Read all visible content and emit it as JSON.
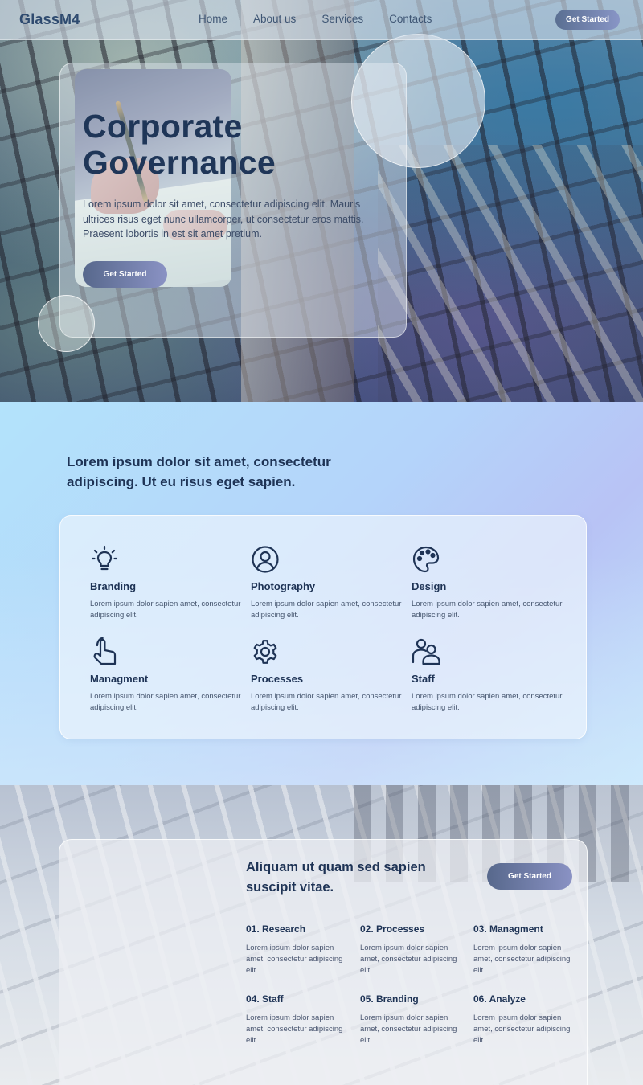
{
  "nav": {
    "logo": "GlassM4",
    "links": [
      "Home",
      "About us",
      "Services",
      "Contacts"
    ],
    "cta": "Get Started"
  },
  "hero": {
    "title": "Corporate Governance",
    "text": "Lorem ipsum dolor sit amet, consectetur adipiscing elit. Mauris ultrices risus eget nunc ullamcorper, ut consectetur eros mattis. Praesent lobortis in est sit amet pretium.",
    "cta": "Get Started"
  },
  "features": {
    "heading": "Lorem ipsum dolor sit amet, consectetur adipiscing. Ut eu risus eget sapien.",
    "items": [
      {
        "icon": "lightbulb-icon",
        "title": "Branding",
        "text": "Lorem ipsum dolor sapien amet, consectetur adipiscing elit."
      },
      {
        "icon": "user-circle-icon",
        "title": "Photography",
        "text": "Lorem ipsum dolor sapien amet, consectetur adipiscing elit."
      },
      {
        "icon": "palette-icon",
        "title": "Design",
        "text": "Lorem ipsum dolor sapien amet, consectetur adipiscing elit."
      },
      {
        "icon": "hand-pointer-icon",
        "title": "Managment",
        "text": "Lorem ipsum dolor sapien amet, consectetur adipiscing elit."
      },
      {
        "icon": "gear-icon",
        "title": "Processes",
        "text": "Lorem ipsum dolor sapien amet, consectetur adipiscing elit."
      },
      {
        "icon": "users-icon",
        "title": "Staff",
        "text": "Lorem ipsum dolor sapien amet, consectetur adipiscing elit."
      }
    ]
  },
  "process": {
    "title": "Aliquam ut quam sed sapien suscipit vitae.",
    "cta": "Get Started",
    "steps": [
      {
        "title": "01. Research",
        "text": "Lorem ipsum dolor sapien amet, consectetur adipiscing elit."
      },
      {
        "title": "02. Processes",
        "text": "Lorem ipsum dolor sapien amet, consectetur adipiscing elit."
      },
      {
        "title": "03. Managment",
        "text": "Lorem ipsum dolor sapien amet, consectetur adipiscing elit."
      },
      {
        "title": "04. Staff",
        "text": "Lorem ipsum dolor sapien amet, consectetur adipiscing elit."
      },
      {
        "title": "05. Branding",
        "text": "Lorem ipsum dolor sapien amet, consectetur adipiscing elit."
      },
      {
        "title": "06. Analyze",
        "text": "Lorem ipsum dolor sapien amet, consectetur adipiscing elit."
      }
    ]
  },
  "colors": {
    "text_dark": "#1e3355",
    "button_gradient_start": "#57688c",
    "button_gradient_end": "#8a92c4"
  }
}
